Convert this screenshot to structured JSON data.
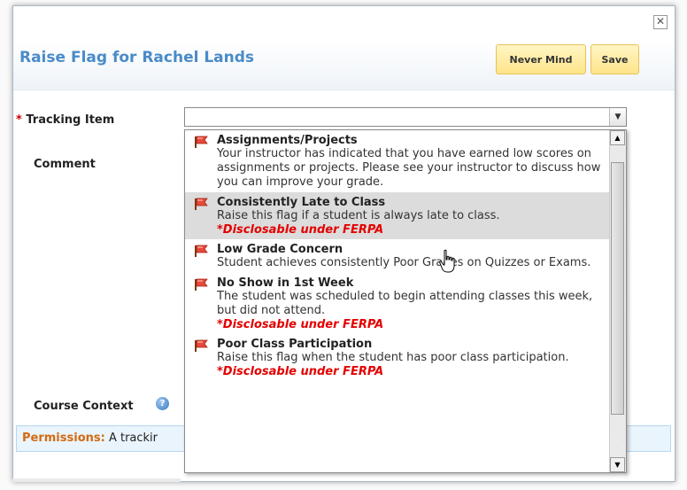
{
  "dialog": {
    "close_glyph": "✕",
    "title": "Raise Flag for Rachel Lands",
    "never_mind_label": "Never Mind",
    "save_label": "Save"
  },
  "form": {
    "tracking_star": "*",
    "tracking_label": "Tracking Item",
    "comment_label": "Comment",
    "context_label": "Course Context",
    "permissions_label": "Permissions:",
    "permissions_text": " A trackir"
  },
  "dropdown": {
    "options": [
      {
        "title": "Assignments/Projects",
        "description": "Your instructor has indicated that you have earned low scores on assignments or projects. Please see your instructor to discuss how you can improve your grade.",
        "ferpa": ""
      },
      {
        "title": "Consistently Late to Class",
        "description": "Raise this flag if a student is always late to class.",
        "ferpa": "*Disclosable under FERPA"
      },
      {
        "title": "Low Grade Concern",
        "description": "Student achieves consistently Poor Grades on Quizzes or Exams.",
        "ferpa": ""
      },
      {
        "title": "No Show in 1st Week",
        "description": "The student was scheduled to begin attending classes this week, but did not attend.",
        "ferpa": "*Disclosable under FERPA"
      },
      {
        "title": "Poor Class Participation",
        "description": "Raise this flag when the student has poor class participation.",
        "ferpa": "*Disclosable under FERPA"
      }
    ]
  },
  "icons": {
    "flag": "flag-icon",
    "help": "help-icon",
    "close": "close-icon",
    "cursor": "hand-cursor-icon"
  },
  "colors": {
    "title_blue": "#4a8bc8",
    "ferpa_red": "#e30000",
    "button_yellow": "#ffe48a",
    "permissions_orange": "#d36a12"
  }
}
